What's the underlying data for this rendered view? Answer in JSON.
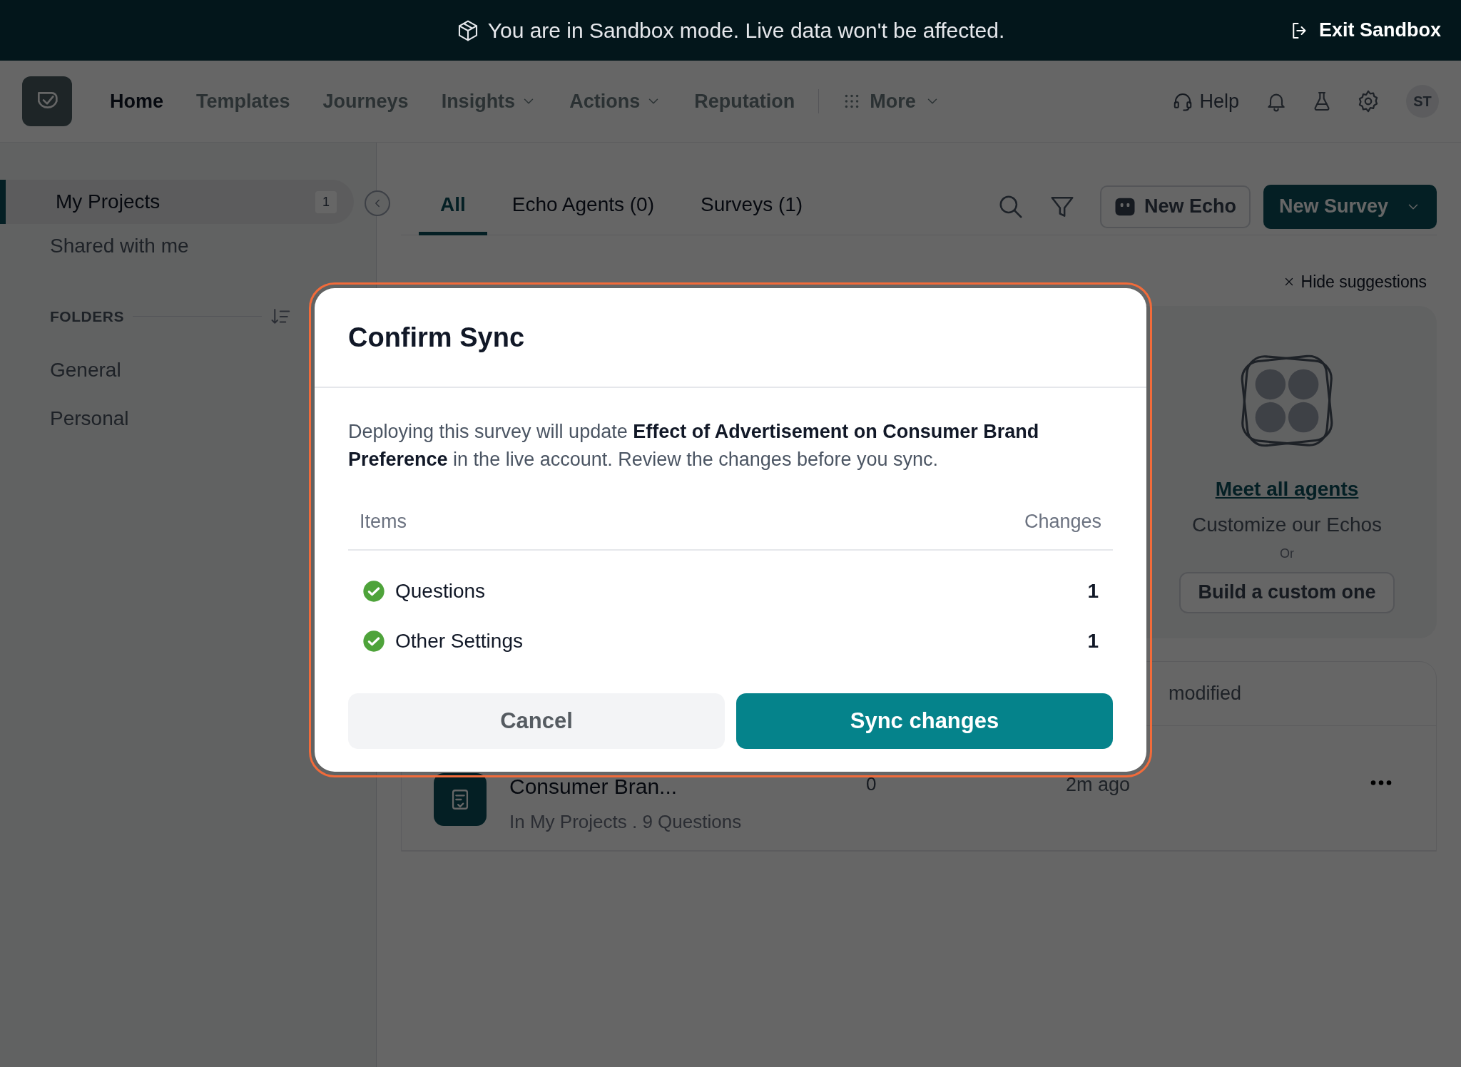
{
  "sandbox_banner": {
    "message": "You are in Sandbox mode. Live data won't be affected.",
    "exit_label": "Exit Sandbox"
  },
  "nav": {
    "items": [
      {
        "label": "Home",
        "selected": true,
        "dropdown": false
      },
      {
        "label": "Templates",
        "selected": false,
        "dropdown": false
      },
      {
        "label": "Journeys",
        "selected": false,
        "dropdown": false
      },
      {
        "label": "Insights",
        "selected": false,
        "dropdown": true
      },
      {
        "label": "Actions",
        "selected": false,
        "dropdown": true
      },
      {
        "label": "Reputation",
        "selected": false,
        "dropdown": false
      }
    ],
    "more_label": "More",
    "help_label": "Help",
    "avatar_initials": "ST"
  },
  "sidebar": {
    "items": [
      {
        "label": "My Projects",
        "selected": true,
        "count": "1"
      },
      {
        "label": "Shared with me",
        "selected": false
      }
    ],
    "folders_heading": "FOLDERS",
    "folders": [
      "General",
      "Personal"
    ]
  },
  "tabs": [
    {
      "label": "All",
      "selected": true
    },
    {
      "label": "Echo Agents (0)",
      "selected": false
    },
    {
      "label": "Surveys (1)",
      "selected": false
    }
  ],
  "toolbar": {
    "new_echo_label": "New Echo",
    "new_survey_label": "New Survey"
  },
  "suggestions": {
    "hide_label": "Hide suggestions",
    "link": "Meet all agents",
    "subtitle": "Customize our Echos",
    "or_text": "Or",
    "build_button": "Build a custom one"
  },
  "list": {
    "header_text": "modified",
    "rows": [
      {
        "title": "Consumer Bran...",
        "subtitle": "In My Projects . 9 Questions",
        "column_3": "0",
        "modified": "2m ago"
      }
    ]
  },
  "dialog": {
    "title": "Confirm Sync",
    "message": "Deploying this survey will update **Effect of Advertisement on Consumer Brand Preference** in the live account. Review the changes before you sync.",
    "columns": [
      "Items",
      "Changes"
    ],
    "rows": [
      {
        "label": "Questions",
        "count": "1",
        "done": true
      },
      {
        "label": "Other Settings",
        "count": "1",
        "done": true
      }
    ],
    "cancel_label": "Cancel",
    "confirm_label": "Sync changes"
  }
}
